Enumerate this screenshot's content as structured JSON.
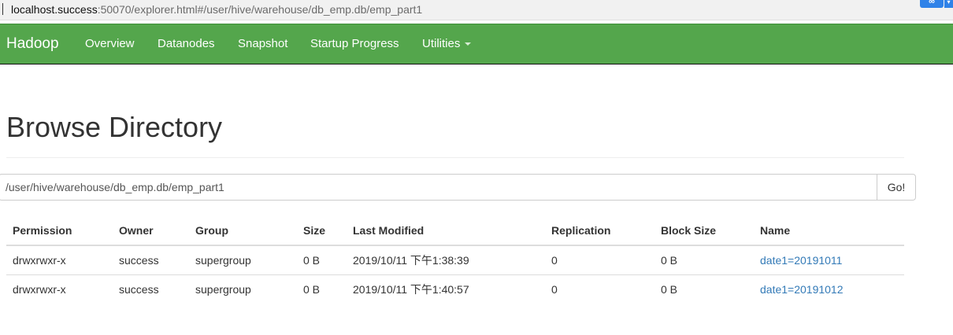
{
  "browser": {
    "url_host": "localhost.success",
    "url_rest": ":50070/explorer.html#/user/hive/warehouse/db_emp.db/emp_part1",
    "extension_icon": "cloud-icon"
  },
  "navbar": {
    "brand": "Hadoop",
    "items": [
      {
        "label": "Overview"
      },
      {
        "label": "Datanodes"
      },
      {
        "label": "Snapshot"
      },
      {
        "label": "Startup Progress"
      },
      {
        "label": "Utilities"
      }
    ],
    "background_color": "#54a64c"
  },
  "page": {
    "title": "Browse Directory"
  },
  "path_bar": {
    "value": "/user/hive/warehouse/db_emp.db/emp_part1",
    "go_label": "Go!"
  },
  "table": {
    "headers": [
      "Permission",
      "Owner",
      "Group",
      "Size",
      "Last Modified",
      "Replication",
      "Block Size",
      "Name"
    ],
    "rows": [
      {
        "permission": "drwxrwxr-x",
        "owner": "success",
        "group": "supergroup",
        "size": "0 B",
        "last_modified": "2019/10/11 下午1:38:39",
        "replication": "0",
        "block_size": "0 B",
        "name": "date1=20191011"
      },
      {
        "permission": "drwxrwxr-x",
        "owner": "success",
        "group": "supergroup",
        "size": "0 B",
        "last_modified": "2019/10/11 下午1:40:57",
        "replication": "0",
        "block_size": "0 B",
        "name": "date1=20191012"
      }
    ],
    "link_color": "#337ab7"
  }
}
